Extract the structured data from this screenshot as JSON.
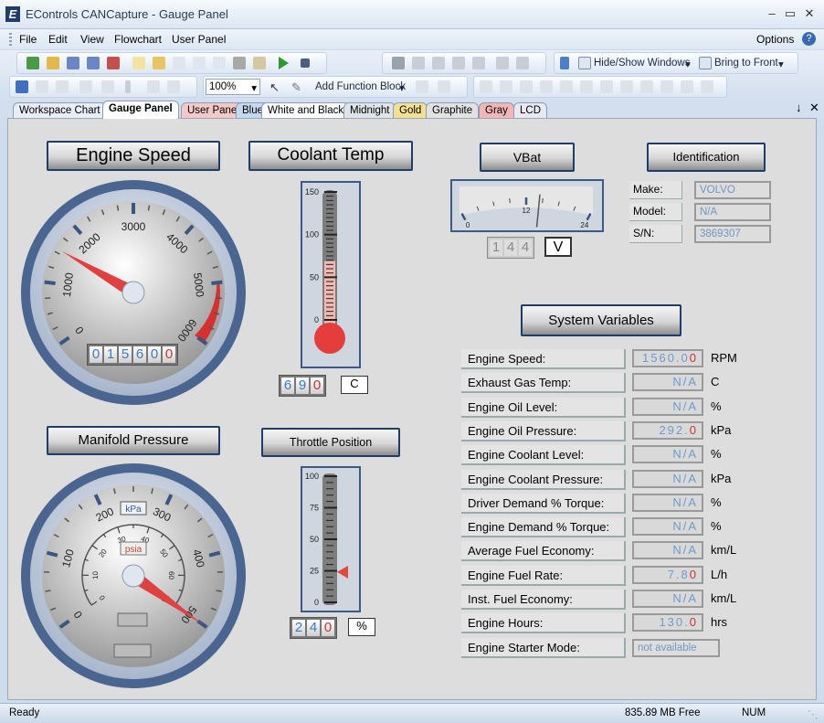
{
  "window": {
    "title": "EControls CANCapture - Gauge Panel",
    "logo": "E"
  },
  "menu": [
    "File",
    "Edit",
    "View",
    "Flowchart",
    "User Panel"
  ],
  "menu_right": "Options",
  "toolbar": {
    "zoom": "100%",
    "hide_show": "Hide/Show Windows",
    "bring_front": "Bring to Front",
    "add_function": "Add Function Block"
  },
  "tabs": [
    {
      "label": "Workspace Chart",
      "color": "#e8eef7"
    },
    {
      "label": "Gauge Panel",
      "color": "#ffffff"
    },
    {
      "label": "User Panel",
      "color": "#f6c8c8"
    },
    {
      "label": "Blue",
      "color": "#c4d8f0"
    },
    {
      "label": "White and Black",
      "color": "#ffffff"
    },
    {
      "label": "Midnight",
      "color": "#dfe3ea"
    },
    {
      "label": "Gold",
      "color": "#f5e090"
    },
    {
      "label": "Graphite",
      "color": "#e2e2e2"
    },
    {
      "label": "Gray",
      "color": "#f3b6b6"
    },
    {
      "label": "LCD",
      "color": "#e9e9f4"
    }
  ],
  "gauges": {
    "engine_speed": {
      "title": "Engine Speed",
      "ticks": [
        "0",
        "1000",
        "2000",
        "3000",
        "4000",
        "5000",
        "6000"
      ],
      "value": 1560,
      "readout": [
        "0",
        "1",
        "5",
        "6",
        "0",
        "0"
      ]
    },
    "coolant": {
      "title": "Coolant Temp",
      "ticks": [
        "150",
        "100",
        "50",
        "0"
      ],
      "value": 69.0,
      "readout": [
        "6",
        "9",
        "0"
      ],
      "unit": "C"
    },
    "vbat": {
      "title": "VBat",
      "ticks": [
        "0",
        "12",
        "24"
      ],
      "value": 14.4,
      "readout": [
        "1",
        "4",
        "4"
      ],
      "unit": "V"
    },
    "manifold": {
      "title": "Manifold Pressure",
      "outer_ticks": [
        "0",
        "100",
        "200",
        "300",
        "400",
        "500"
      ],
      "inner_ticks": [
        "0",
        "10",
        "20",
        "30",
        "40",
        "50",
        "60",
        "70"
      ],
      "unit_outer": "kPa",
      "unit_inner": "psia"
    },
    "throttle": {
      "title": "Throttle Position",
      "ticks": [
        "100",
        "75",
        "50",
        "25",
        "0"
      ],
      "value": 24.0,
      "readout": [
        "2",
        "4",
        "0"
      ],
      "unit": "%"
    }
  },
  "identification": {
    "title": "Identification",
    "rows": [
      {
        "label": "Make:",
        "value": "VOLVO"
      },
      {
        "label": "Model:",
        "value": "N/A"
      },
      {
        "label": "S/N:",
        "value": "3869307"
      }
    ]
  },
  "system_variables": {
    "title": "System Variables",
    "rows": [
      {
        "label": "Engine Speed:",
        "value": "1560.0",
        "red": "0",
        "unit": "RPM"
      },
      {
        "label": "Exhaust Gas Temp:",
        "value": "N/A",
        "red": "",
        "unit": "C"
      },
      {
        "label": "Engine Oil Level:",
        "value": "N/A",
        "red": "",
        "unit": "%"
      },
      {
        "label": "Engine Oil Pressure:",
        "value": "292.",
        "red": "0",
        "unit": "kPa"
      },
      {
        "label": "Engine Coolant Level:",
        "value": "N/A",
        "red": "",
        "unit": "%"
      },
      {
        "label": "Engine Coolant Pressure:",
        "value": "N/A",
        "red": "",
        "unit": "kPa"
      },
      {
        "label": "Driver Demand % Torque:",
        "value": "N/A",
        "red": "",
        "unit": "%"
      },
      {
        "label": "Engine Demand % Torque:",
        "value": "N/A",
        "red": "",
        "unit": "%"
      },
      {
        "label": "Average Fuel Economy:",
        "value": "N/A",
        "red": "",
        "unit": "km/L"
      },
      {
        "label": "Engine Fuel Rate:",
        "value": "7.8",
        "red": "0",
        "unit": "L/h"
      },
      {
        "label": "Inst. Fuel Economy:",
        "value": "N/A",
        "red": "",
        "unit": "km/L"
      },
      {
        "label": "Engine Hours:",
        "value": "130.",
        "red": "0",
        "unit": "hrs"
      },
      {
        "label": "Engine Starter Mode:",
        "value": "not available",
        "red": "",
        "unit": ""
      }
    ]
  },
  "status": {
    "left": "Ready",
    "memory": "835.89 MB Free",
    "num": "NUM"
  }
}
